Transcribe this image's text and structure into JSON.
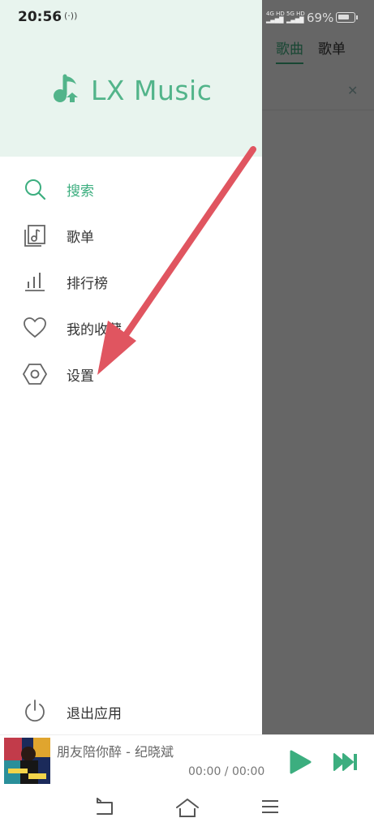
{
  "status_bar": {
    "time": "20:56",
    "nfc": "(·))",
    "sim1": "4G HD",
    "sim2": "5G HD",
    "battery_percent": "69%"
  },
  "background": {
    "tabs": [
      {
        "label": "歌曲",
        "active": true
      },
      {
        "label": "歌单",
        "active": false
      }
    ]
  },
  "drawer": {
    "app_name": "LX Music",
    "menu": [
      {
        "label": "搜索",
        "icon": "search-icon",
        "active": true
      },
      {
        "label": "歌单",
        "icon": "playlist-icon",
        "active": false
      },
      {
        "label": "排行榜",
        "icon": "chart-icon",
        "active": false
      },
      {
        "label": "我的收藏",
        "icon": "heart-icon",
        "active": false
      },
      {
        "label": "设置",
        "icon": "settings-icon",
        "active": false
      }
    ],
    "exit_label": "退出应用"
  },
  "player": {
    "song": "朋友陪你醉 - 纪晓斌",
    "time": "00:00 / 00:00"
  },
  "colors": {
    "accent": "#3cae7f",
    "header_bg": "#e8f4ee",
    "arrow": "#e05560"
  }
}
